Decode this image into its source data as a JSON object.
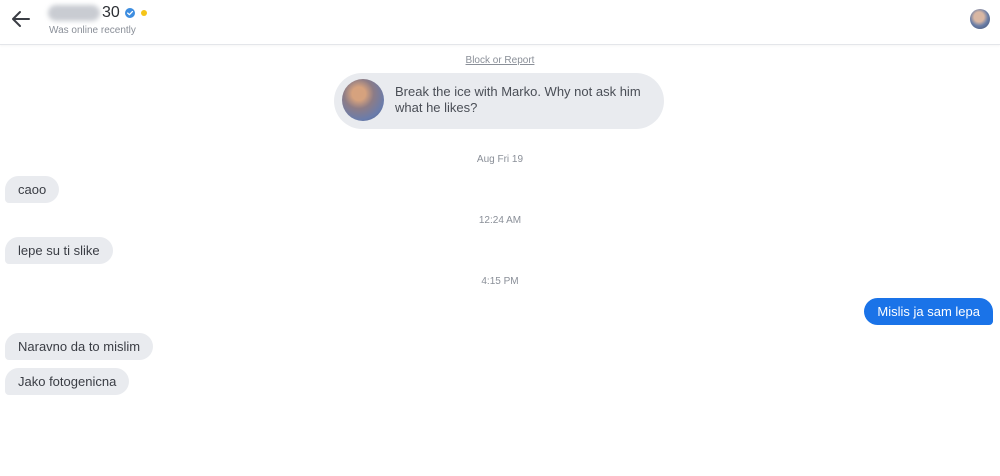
{
  "header": {
    "name_suffix": "30",
    "status": "Was online recently",
    "verified_color": "#3d8de0",
    "online_dot_color": "#f5c518"
  },
  "chat": {
    "block_report": "Block or Report",
    "icebreaker": "Break the ice with Marko. Why not ask him what he likes?",
    "timestamps": [
      "Aug Fri 19",
      "12:24 AM",
      "4:15 PM"
    ],
    "messages": [
      {
        "from": "them",
        "text": "caoo"
      },
      {
        "from": "them",
        "text": "lepe su ti slike"
      },
      {
        "from": "me",
        "text": "Mislis ja sam lepa"
      },
      {
        "from": "them",
        "text": "Naravno da to mislim"
      },
      {
        "from": "them",
        "text": "Jako fotogenicna"
      }
    ]
  },
  "colors": {
    "outgoing_bubble": "#1a73e8",
    "incoming_bubble": "#e9ebef"
  }
}
